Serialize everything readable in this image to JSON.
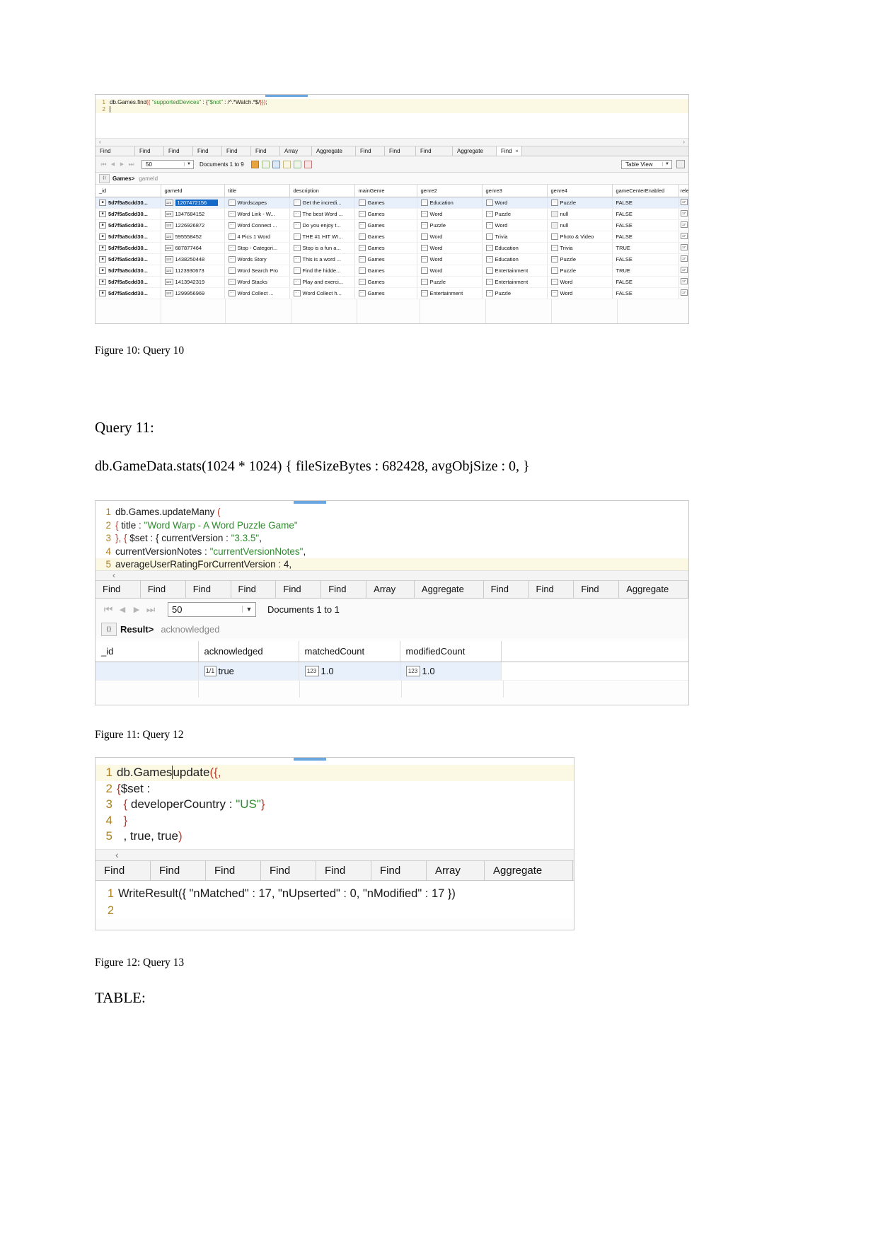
{
  "document": {
    "figure10_caption": "Figure 10: Query 10",
    "query11_heading": "Query 11:",
    "query11_body": "db.GameData.stats(1024 * 1024) { fileSizeBytes : 682428, avgObjSize : 0, }",
    "figure11_caption": "Figure 11: Query 12",
    "figure12_caption": "Figure 12: Query 13",
    "table_heading": "TABLE:"
  },
  "figure10": {
    "editor": {
      "lines": [
        {
          "no": "1",
          "segments": [
            {
              "t": "db.Games.find",
              "c": "black"
            },
            {
              "t": "({",
              "c": "red"
            },
            {
              "t": " \"supportedDevices\" ",
              "c": "green"
            },
            {
              "t": ": {",
              "c": "black"
            },
            {
              "t": "\"$not\"",
              "c": "green"
            },
            {
              "t": " : /^.*Watch.*$/",
              "c": "black"
            },
            {
              "t": "}})",
              "c": "red"
            },
            {
              "t": ";",
              "c": "black"
            }
          ]
        },
        {
          "no": "2",
          "segments": [
            {
              "t": "",
              "c": "black"
            }
          ]
        }
      ],
      "scroll_left": "‹",
      "scroll_right": "›"
    },
    "tabs": [
      "Find",
      "Find",
      "Find",
      "Find",
      "Find",
      "Find",
      "Array",
      "Aggregate",
      "Find",
      "Find",
      "Find",
      "Aggregate",
      "Find"
    ],
    "active_tab_close": "✕",
    "toolbar": {
      "first_label": "⏮",
      "prev_label": "◀",
      "next_label": "▶",
      "last_label": "⏭",
      "page_size": "50",
      "docs_label": "Documents 1 to 9",
      "view_mode": "Table View",
      "icons": [
        "lock-icon",
        "export-icon",
        "json-icon",
        "edit-icon",
        "edit-doc-icon",
        "delete-icon",
        "settings-icon"
      ]
    },
    "breadcrumb": {
      "root": "Games>",
      "field": "gameId",
      "chevron": "⟨⟩"
    },
    "grid": {
      "columns": [
        "_id",
        "gameId",
        "title",
        "description",
        "mainGenre",
        "genre2",
        "genre3",
        "genre4",
        "gameCenterEnabled",
        "relea"
      ],
      "rows": [
        {
          "selected": true,
          "cells": [
            "5d7f5a5cdd30...",
            "1207472156",
            "Wordscapes",
            "Get the incredi...",
            "Games",
            "Education",
            "Word",
            "Puzzle",
            "FALSE",
            ""
          ],
          "types": [
            "id",
            "num",
            "str",
            "str",
            "str",
            "str",
            "str",
            "str",
            "bool",
            "bool"
          ]
        },
        {
          "selected": false,
          "cells": [
            "5d7f5a5cdd30...",
            "1347684152",
            "Word Link - W...",
            "The best Word ...",
            "Games",
            "Word",
            "Puzzle",
            "null",
            "FALSE",
            ""
          ],
          "types": [
            "id",
            "num",
            "str",
            "str",
            "str",
            "str",
            "str",
            "empty",
            "bool",
            "bool"
          ]
        },
        {
          "selected": false,
          "cells": [
            "5d7f5a5cdd30...",
            "1226926872",
            "Word Connect ...",
            "Do you enjoy t...",
            "Games",
            "Puzzle",
            "Word",
            "null",
            "FALSE",
            ""
          ],
          "types": [
            "id",
            "num",
            "str",
            "str",
            "str",
            "str",
            "str",
            "empty",
            "bool",
            "bool"
          ]
        },
        {
          "selected": false,
          "cells": [
            "5d7f5a5cdd30...",
            "595558452",
            "4 Pics 1 Word",
            "THE #1 HIT WI...",
            "Games",
            "Word",
            "Trivia",
            "Photo & Video",
            "FALSE",
            ""
          ],
          "types": [
            "id",
            "num",
            "str",
            "str",
            "str",
            "str",
            "str",
            "str",
            "bool",
            "bool"
          ]
        },
        {
          "selected": false,
          "cells": [
            "5d7f5a5cdd30...",
            "687877464",
            "Stop - Categori...",
            "Stop is a fun a...",
            "Games",
            "Word",
            "Education",
            "Trivia",
            "TRUE",
            ""
          ],
          "types": [
            "id",
            "num",
            "str",
            "str",
            "str",
            "str",
            "str",
            "str",
            "bool",
            "bool"
          ]
        },
        {
          "selected": false,
          "cells": [
            "5d7f5a5cdd30...",
            "1438250448",
            "Words Story",
            "This is a word ...",
            "Games",
            "Word",
            "Education",
            "Puzzle",
            "FALSE",
            ""
          ],
          "types": [
            "id",
            "num",
            "str",
            "str",
            "str",
            "str",
            "str",
            "str",
            "bool",
            "bool"
          ]
        },
        {
          "selected": false,
          "cells": [
            "5d7f5a5cdd30...",
            "1123930673",
            "Word Search Pro",
            "Find the hidde...",
            "Games",
            "Word",
            "Entertainment",
            "Puzzle",
            "TRUE",
            ""
          ],
          "types": [
            "id",
            "num",
            "str",
            "str",
            "str",
            "str",
            "str",
            "str",
            "bool",
            "bool"
          ]
        },
        {
          "selected": false,
          "cells": [
            "5d7f5a5cdd30...",
            "1413942319",
            "Word Stacks",
            "Play and exerci...",
            "Games",
            "Puzzle",
            "Entertainment",
            "Word",
            "FALSE",
            ""
          ],
          "types": [
            "id",
            "num",
            "str",
            "str",
            "str",
            "str",
            "str",
            "str",
            "bool",
            "bool"
          ]
        },
        {
          "selected": false,
          "cells": [
            "5d7f5a5cdd30...",
            "1299956969",
            "Word Collect ...",
            "Word Collect h...",
            "Games",
            "Entertainment",
            "Puzzle",
            "Word",
            "FALSE",
            ""
          ],
          "types": [
            "id",
            "num",
            "str",
            "str",
            "str",
            "str",
            "str",
            "str",
            "bool",
            "bool"
          ]
        }
      ]
    }
  },
  "figure11": {
    "editor": {
      "lines": [
        {
          "no": "1",
          "segments": [
            {
              "t": "db.Games.updateMany ",
              "c": "black"
            },
            {
              "t": "(",
              "c": "red"
            }
          ]
        },
        {
          "no": "2",
          "segments": [
            {
              "t": "{ ",
              "c": "red"
            },
            {
              "t": "title : ",
              "c": "black"
            },
            {
              "t": "\"Word Warp - A Word Puzzle Game\"",
              "c": "green"
            }
          ]
        },
        {
          "no": "3",
          "segments": [
            {
              "t": "}, { ",
              "c": "red"
            },
            {
              "t": "$set : { ",
              "c": "black"
            },
            {
              "t": "currentVersion : ",
              "c": "black"
            },
            {
              "t": "\"3.3.5\"",
              "c": "green"
            },
            {
              "t": ",",
              "c": "black"
            }
          ]
        },
        {
          "no": "4",
          "segments": [
            {
              "t": "currentVersionNotes : ",
              "c": "black"
            },
            {
              "t": "\"currentVersionNotes\"",
              "c": "green"
            },
            {
              "t": ",",
              "c": "black"
            }
          ]
        },
        {
          "no": "5",
          "segments": [
            {
              "t": "averageUserRatingForCurrentVersion : 4,",
              "c": "black"
            }
          ]
        }
      ],
      "scroll_left": "‹"
    },
    "tabs": [
      "Find",
      "Find",
      "Find",
      "Find",
      "Find",
      "Find",
      "Array",
      "Aggregate",
      "Find",
      "Find",
      "Find",
      "Aggregate"
    ],
    "toolbar": {
      "first_label": "⏮",
      "prev_label": "◀",
      "next_label": "▶",
      "last_label": "⏭",
      "page_size": "50",
      "docs_label": "Documents 1 to 1"
    },
    "breadcrumb": {
      "root": "Result>",
      "field": "acknowledged",
      "chevron": "⟨⟩"
    },
    "grid": {
      "columns": [
        "_id",
        "acknowledged",
        "matchedCount",
        "modifiedCount",
        ""
      ],
      "rows": [
        {
          "selected": true,
          "cells": [
            "",
            "true",
            "1.0",
            "1.0",
            ""
          ],
          "types": [
            "none",
            "bool",
            "num",
            "num",
            "none"
          ]
        }
      ]
    }
  },
  "figure12": {
    "editor": {
      "lines": [
        {
          "no": "1",
          "segments": [
            {
              "t": "db.Games",
              "c": "black"
            },
            {
              "t": "|",
              "c": "black"
            },
            {
              "t": "update",
              "c": "black"
            },
            {
              "t": "({,",
              "c": "red"
            }
          ]
        },
        {
          "no": "2",
          "segments": [
            {
              "t": "{",
              "c": "red"
            },
            {
              "t": "$set :",
              "c": "black"
            }
          ]
        },
        {
          "no": "3",
          "segments": [
            {
              "t": "  { ",
              "c": "red"
            },
            {
              "t": "developerCountry : ",
              "c": "black"
            },
            {
              "t": "\"US\"",
              "c": "green"
            },
            {
              "t": "}",
              "c": "red"
            }
          ]
        },
        {
          "no": "4",
          "segments": [
            {
              "t": "  }",
              "c": "red"
            }
          ]
        },
        {
          "no": "5",
          "segments": [
            {
              "t": "  , true, true",
              "c": "black"
            },
            {
              "t": ")",
              "c": "red"
            }
          ]
        }
      ],
      "scroll_left": "‹"
    },
    "tabs": [
      "Find",
      "Find",
      "Find",
      "Find",
      "Find",
      "Find",
      "Array",
      "Aggregate"
    ],
    "output": {
      "lines": [
        {
          "no": "1",
          "text": "WriteResult({ \"nMatched\" : 17, \"nUpserted\" : 0, \"nModified\" : 17 })"
        },
        {
          "no": "2",
          "text": ""
        }
      ]
    }
  },
  "colors": {
    "accent": "#1569c7",
    "selection_row": "#e8f0fb",
    "code_highlight": "#fbf8e3",
    "string_green": "#2e8b2e",
    "bracket_red": "#c0392b",
    "gutter": "#b08020"
  }
}
